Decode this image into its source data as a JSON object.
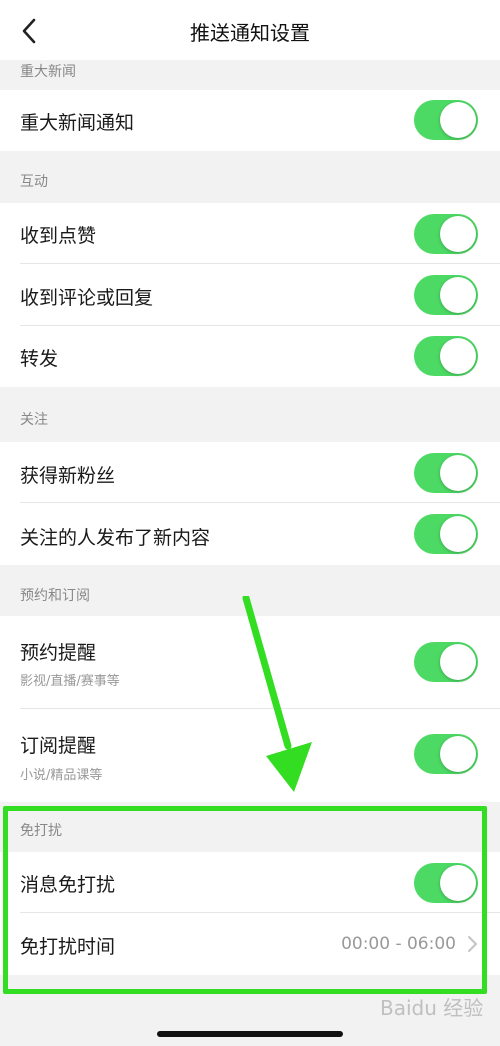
{
  "nav": {
    "title": "推送通知设置"
  },
  "sections": {
    "major_news": {
      "header": "重大新闻",
      "items": [
        {
          "label": "重大新闻通知",
          "on": true
        }
      ]
    },
    "interaction": {
      "header": "互动",
      "items": [
        {
          "label": "收到点赞",
          "on": true
        },
        {
          "label": "收到评论或回复",
          "on": true
        },
        {
          "label": "转发",
          "on": true
        }
      ]
    },
    "follow": {
      "header": "关注",
      "items": [
        {
          "label": "获得新粉丝",
          "on": true
        },
        {
          "label": "关注的人发布了新内容",
          "on": true
        }
      ]
    },
    "subscribe": {
      "header": "预约和订阅",
      "items": [
        {
          "label": "预约提醒",
          "sub": "影视/直播/赛事等",
          "on": true
        },
        {
          "label": "订阅提醒",
          "sub": "小说/精品课等",
          "on": true
        }
      ]
    },
    "dnd": {
      "header": "免打扰",
      "items": [
        {
          "label": "消息免打扰",
          "on": true
        },
        {
          "label": "免打扰时间",
          "value": "00:00 - 06:00"
        }
      ]
    }
  },
  "watermark": "Baidu 经验",
  "colors": {
    "toggle_on": "#4cd964",
    "highlight": "#33dd22"
  }
}
